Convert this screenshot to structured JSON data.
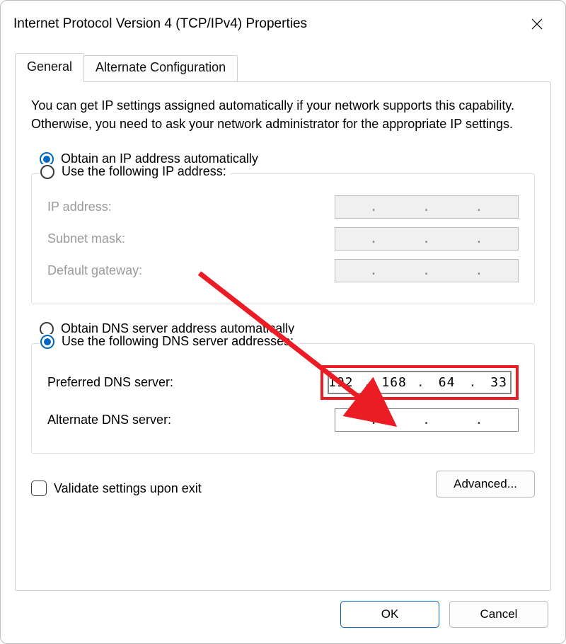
{
  "title": "Internet Protocol Version 4 (TCP/IPv4) Properties",
  "tabs": {
    "general": "General",
    "alternate": "Alternate Configuration"
  },
  "description": "You can get IP settings assigned automatically if your network supports this capability. Otherwise, you need to ask your network administrator for the appropriate IP settings.",
  "ip_section": {
    "auto_label": "Obtain an IP address automatically",
    "manual_label": "Use the following IP address:",
    "ip_label": "IP address:",
    "subnet_label": "Subnet mask:",
    "gateway_label": "Default gateway:",
    "selected": "auto",
    "ipaddress": [
      "",
      "",
      "",
      ""
    ],
    "subnet": [
      "",
      "",
      "",
      ""
    ],
    "gateway": [
      "",
      "",
      "",
      ""
    ]
  },
  "dns_section": {
    "auto_label": "Obtain DNS server address automatically",
    "manual_label": "Use the following DNS server addresses:",
    "preferred_label": "Preferred DNS server:",
    "alternate_label": "Alternate DNS server:",
    "selected": "manual",
    "preferred": [
      "192",
      "168",
      "64",
      "33"
    ],
    "alternate": [
      "",
      "",
      "",
      ""
    ]
  },
  "validate_label": "Validate settings upon exit",
  "validate_checked": false,
  "advanced_label": "Advanced...",
  "buttons": {
    "ok": "OK",
    "cancel": "Cancel"
  },
  "annotation": {
    "color": "#ec1c24"
  }
}
